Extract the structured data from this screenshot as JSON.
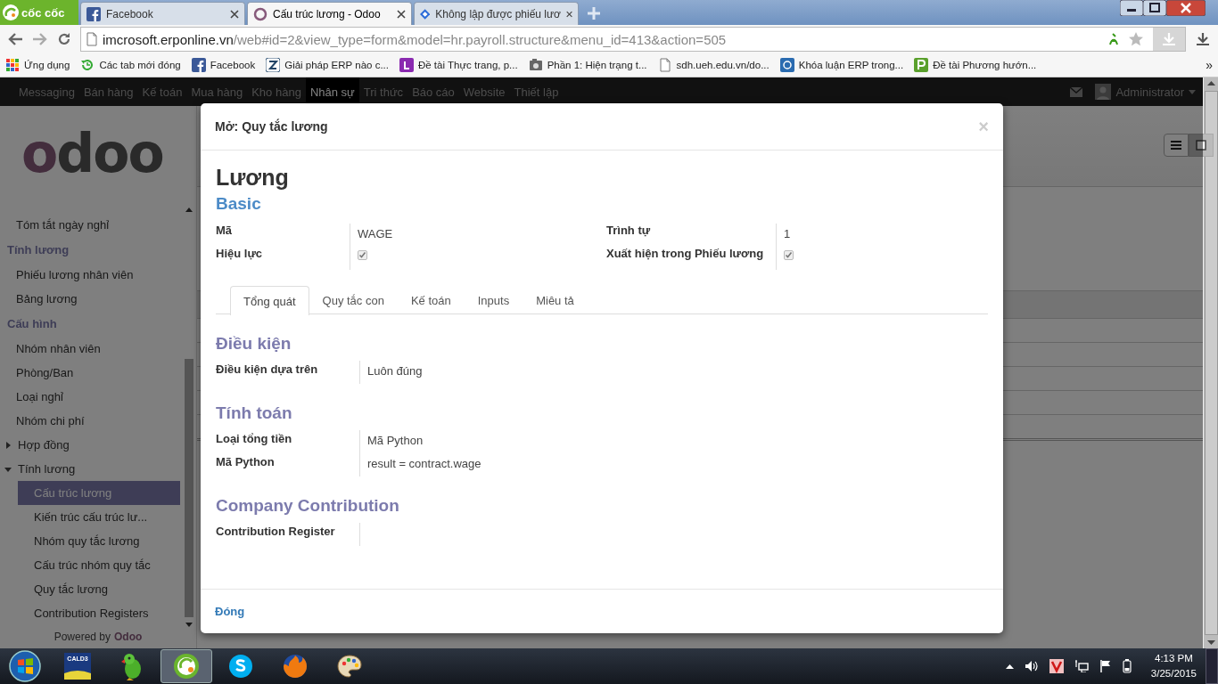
{
  "browser": {
    "brand": "cốc cốc",
    "tabs": [
      {
        "kind": "facebook",
        "title": "Facebook",
        "selected": false
      },
      {
        "kind": "odoo",
        "title": "Cấu trúc lương - Odoo",
        "selected": true
      },
      {
        "kind": "blog",
        "title": "Không lập được phiếu lươ",
        "selected": false
      }
    ],
    "url_host": "imcrosoft.erponline.vn",
    "url_path": "/web#id=2&view_type=form&model=hr.payroll.structure&menu_id=413&action=505",
    "bookmarks": [
      {
        "kind": "apps",
        "label": "Ứng dụng"
      },
      {
        "kind": "history",
        "label": "Các tab mới đóng"
      },
      {
        "kind": "facebook",
        "label": "Facebook"
      },
      {
        "kind": "z",
        "label": "Giải pháp ERP nào c..."
      },
      {
        "kind": "l",
        "label": "Đề tài Thực trang, p..."
      },
      {
        "kind": "camera",
        "label": "Phần 1: Hiện trạng t..."
      },
      {
        "kind": "page",
        "label": "sdh.ueh.edu.vn/do..."
      },
      {
        "kind": "at",
        "label": "Khóa luận ERP trong..."
      },
      {
        "kind": "p",
        "label": "Đề tài Phương hướn..."
      }
    ],
    "bookmarks_more": "»"
  },
  "top_menu": [
    {
      "label": "Messaging",
      "selected": false
    },
    {
      "label": "Bán hàng",
      "selected": false
    },
    {
      "label": "Kế toán",
      "selected": false
    },
    {
      "label": "Mua hàng",
      "selected": false
    },
    {
      "label": "Kho hàng",
      "selected": false
    },
    {
      "label": "Nhân sự",
      "selected": true
    },
    {
      "label": "Tri thức",
      "selected": false
    },
    {
      "label": "Báo cáo",
      "selected": false
    },
    {
      "label": "Website",
      "selected": false
    },
    {
      "label": "Thiết lập",
      "selected": false
    }
  ],
  "user": "Administrator",
  "sidebar": {
    "logo": "odoo",
    "sections": [
      {
        "items": [
          {
            "label": "Tóm tắt ngày nghỉ",
            "selected": false
          }
        ]
      },
      {
        "title": "Tính lương",
        "items": [
          {
            "label": "Phiếu lương nhân viên",
            "selected": false
          },
          {
            "label": "Bảng lương",
            "selected": false
          }
        ]
      },
      {
        "title": "Cấu hình",
        "items": [
          {
            "label": "Nhóm nhân viên",
            "selected": false
          },
          {
            "label": "Phòng/Ban",
            "selected": false
          },
          {
            "label": "Loại nghỉ",
            "selected": false
          },
          {
            "label": "Nhóm chi phí",
            "selected": false
          },
          {
            "label": "Hợp đồng",
            "selected": false,
            "expanded": false
          },
          {
            "label": "Tính lương",
            "selected": false,
            "expanded": true,
            "children": [
              {
                "label": "Cấu trúc lương",
                "selected": true
              },
              {
                "label": "Kiến trúc cấu trúc lư...",
                "selected": false
              },
              {
                "label": "Nhóm quy tắc lương",
                "selected": false
              },
              {
                "label": "Cấu trúc nhóm quy tắc",
                "selected": false
              },
              {
                "label": "Quy tắc lương",
                "selected": false
              },
              {
                "label": "Contribution Registers",
                "selected": false
              }
            ]
          }
        ]
      }
    ],
    "powered_by": "Powered by",
    "powered_brand": "Odoo"
  },
  "modal": {
    "title": "Mở: Quy tắc lương",
    "close": "×",
    "name": "Lương",
    "category": "Basic",
    "left_fields": [
      {
        "kind": "text",
        "label": "Mã",
        "value": "WAGE"
      },
      {
        "kind": "checkbox",
        "label": "Hiệu lực",
        "checked": true
      }
    ],
    "right_fields": [
      {
        "kind": "text",
        "label": "Trình tự",
        "value": "1"
      },
      {
        "kind": "checkbox",
        "label": "Xuất hiện trong Phiếu lương",
        "checked": true
      }
    ],
    "tabs": [
      {
        "label": "Tổng quát",
        "selected": true
      },
      {
        "label": "Quy tắc con",
        "selected": false
      },
      {
        "label": "Kế toán",
        "selected": false
      },
      {
        "label": "Inputs",
        "selected": false
      },
      {
        "label": "Miêu tả",
        "selected": false
      }
    ],
    "sections": [
      {
        "title": "Điều kiện",
        "fields": [
          {
            "label": "Điều kiện dựa trên",
            "value": "Luôn đúng"
          }
        ]
      },
      {
        "title": "Tính toán",
        "fields": [
          {
            "label": "Loại tổng tiền",
            "value": "Mã Python"
          },
          {
            "label": "Mã Python",
            "value": "result = contract.wage"
          }
        ]
      },
      {
        "title": "Company Contribution",
        "fields": [
          {
            "label": "Contribution Register"
          }
        ]
      }
    ],
    "footer_button": "Đóng"
  },
  "taskbar": {
    "apps": [
      {
        "kind": "cald",
        "label": "CALD3",
        "selected": false
      },
      {
        "kind": "parrot",
        "selected": false
      },
      {
        "kind": "coccoc",
        "selected": true
      },
      {
        "kind": "skype",
        "selected": false
      },
      {
        "kind": "firefox",
        "selected": false
      },
      {
        "kind": "paint",
        "selected": false
      }
    ],
    "time": "4:13 PM",
    "date": "3/25/2015"
  }
}
